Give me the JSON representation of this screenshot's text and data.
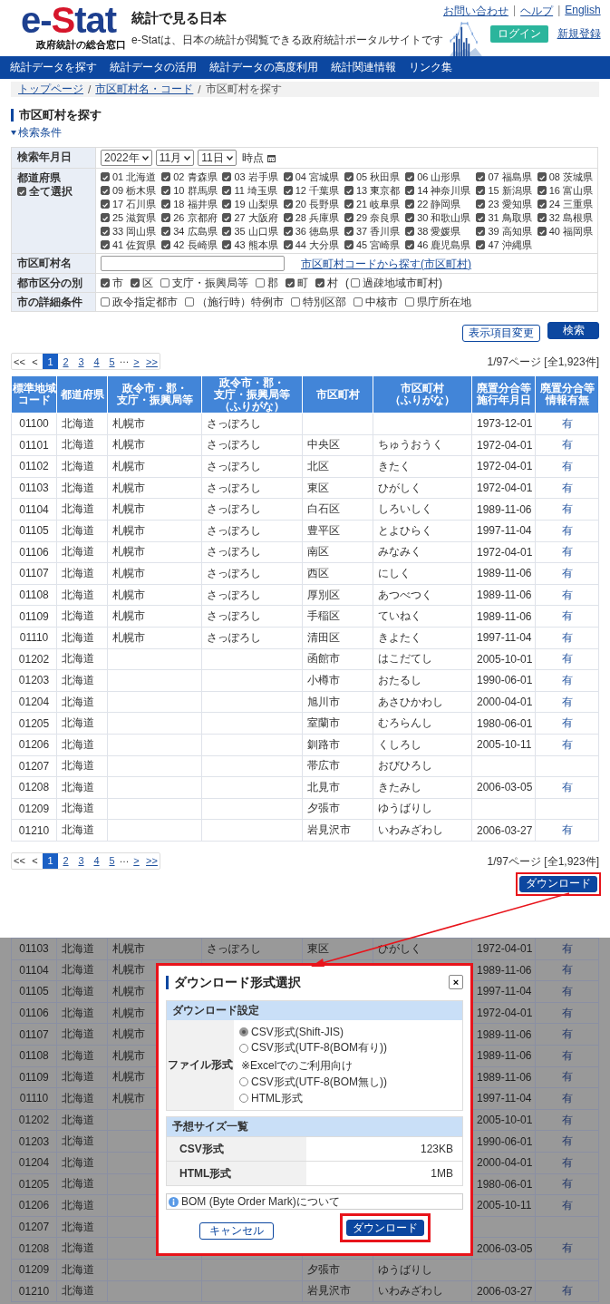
{
  "header": {
    "logo": {
      "parts": [
        {
          "text": "e-",
          "accent": false
        },
        {
          "text": "S",
          "accent": true
        },
        {
          "text": "tat",
          "accent": false
        }
      ],
      "subtitle": "政府統計の総合窓口"
    },
    "title": "統計で見る日本",
    "tagline": "e-Statは、日本の統計が閲覧できる政府統計ポータルサイトです",
    "links": [
      "お問い合わせ",
      "ヘルプ",
      "English"
    ],
    "link_separators": [
      "|",
      "|"
    ],
    "login": "ログイン",
    "register": "新規登録"
  },
  "nav": [
    "統計データを探す",
    "統計データの活用",
    "統計データの高度利用",
    "統計関連情報",
    "リンク集"
  ],
  "breadcrumb": {
    "items": [
      {
        "label": "トップページ",
        "link": true
      },
      {
        "label": "市区町村名・コード",
        "link": true
      },
      {
        "label": "市区町村を探す",
        "link": false
      }
    ],
    "separators": [
      "/",
      "/"
    ]
  },
  "page_title": "市区町村を探す",
  "search_conditions": {
    "label": "検索条件",
    "expanded": true
  },
  "form": [
    {
      "kind": "date",
      "label": "検索年月日",
      "selects": [
        "2022年",
        "11月",
        "11日"
      ],
      "suffix": "時点"
    },
    {
      "kind": "grid",
      "label": "都道府県",
      "select_all": {
        "label": "全て選択",
        "checked": true
      },
      "items": [
        {
          "label": "01 北海道",
          "checked": true
        },
        {
          "label": "02 青森県",
          "checked": true
        },
        {
          "label": "03 岩手県",
          "checked": true
        },
        {
          "label": "04 宮城県",
          "checked": true
        },
        {
          "label": "05 秋田県",
          "checked": true
        },
        {
          "label": "06 山形県",
          "checked": true
        },
        {
          "label": "07 福島県",
          "checked": true
        },
        {
          "label": "08 茨城県",
          "checked": true
        },
        {
          "label": "09 栃木県",
          "checked": true
        },
        {
          "label": "10 群馬県",
          "checked": true
        },
        {
          "label": "11 埼玉県",
          "checked": true
        },
        {
          "label": "12 千葉県",
          "checked": true
        },
        {
          "label": "13 東京都",
          "checked": true
        },
        {
          "label": "14 神奈川県",
          "checked": true
        },
        {
          "label": "15 新潟県",
          "checked": true
        },
        {
          "label": "16 富山県",
          "checked": true
        },
        {
          "label": "17 石川県",
          "checked": true
        },
        {
          "label": "18 福井県",
          "checked": true
        },
        {
          "label": "19 山梨県",
          "checked": true
        },
        {
          "label": "20 長野県",
          "checked": true
        },
        {
          "label": "21 岐阜県",
          "checked": true
        },
        {
          "label": "22 静岡県",
          "checked": true
        },
        {
          "label": "23 愛知県",
          "checked": true
        },
        {
          "label": "24 三重県",
          "checked": true
        },
        {
          "label": "25 滋賀県",
          "checked": true
        },
        {
          "label": "26 京都府",
          "checked": true
        },
        {
          "label": "27 大阪府",
          "checked": true
        },
        {
          "label": "28 兵庫県",
          "checked": true
        },
        {
          "label": "29 奈良県",
          "checked": true
        },
        {
          "label": "30 和歌山県",
          "checked": true
        },
        {
          "label": "31 鳥取県",
          "checked": true
        },
        {
          "label": "32 島根県",
          "checked": true
        },
        {
          "label": "33 岡山県",
          "checked": true
        },
        {
          "label": "34 広島県",
          "checked": true
        },
        {
          "label": "35 山口県",
          "checked": true
        },
        {
          "label": "36 徳島県",
          "checked": true
        },
        {
          "label": "37 香川県",
          "checked": true
        },
        {
          "label": "38 愛媛県",
          "checked": true
        },
        {
          "label": "39 高知県",
          "checked": true
        },
        {
          "label": "40 福岡県",
          "checked": true
        },
        {
          "label": "41 佐賀県",
          "checked": true
        },
        {
          "label": "42 長崎県",
          "checked": true
        },
        {
          "label": "43 熊本県",
          "checked": true
        },
        {
          "label": "44 大分県",
          "checked": true
        },
        {
          "label": "45 宮崎県",
          "checked": true
        },
        {
          "label": "46 鹿児島県",
          "checked": true
        },
        {
          "label": "47 沖縄県",
          "checked": true
        }
      ]
    },
    {
      "kind": "text",
      "label": "市区町村名",
      "link": "市区町村コードから探す(市区町村)"
    },
    {
      "kind": "checks",
      "label": "都市区分の別",
      "items": [
        {
          "label": "市",
          "checked": true
        },
        {
          "label": "区",
          "checked": true
        },
        {
          "label": "支庁・振興局等",
          "checked": false
        },
        {
          "label": "郡",
          "checked": false
        },
        {
          "label": "町",
          "checked": true
        },
        {
          "label": "村",
          "checked": true
        },
        {
          "prefix": "(",
          "label": "過疎地域市町村)",
          "checked": false
        }
      ]
    },
    {
      "kind": "checks",
      "label": "市の詳細条件",
      "items": [
        {
          "label": "政令指定都市",
          "checked": false
        },
        {
          "label": "（施行時）特例市",
          "checked": false
        },
        {
          "label": "特別区部",
          "checked": false
        },
        {
          "label": "中核市",
          "checked": false
        },
        {
          "label": "県庁所在地",
          "checked": false
        }
      ]
    }
  ],
  "buttons": [
    {
      "label": "表示項目変更",
      "kind": "secondary"
    },
    {
      "label": "検索",
      "kind": "primary"
    }
  ],
  "pagination_top": {
    "first": "<<",
    "prev": "<",
    "back_disabled": true,
    "pages": [
      {
        "label": "1",
        "selected": true
      },
      {
        "label": "2",
        "selected": false
      },
      {
        "label": "3",
        "selected": false
      },
      {
        "label": "4",
        "selected": false
      },
      {
        "label": "5",
        "selected": false
      }
    ],
    "ellipsis": "…",
    "next": ">",
    "last": ">>",
    "info": "1/97ページ [全1,923件]"
  },
  "table": {
    "columns": [
      [
        "標準地域",
        "コード"
      ],
      [
        "都道府県"
      ],
      [
        "政令市・郡・",
        "支庁・振興局等"
      ],
      [
        "政令市・郡・",
        "支庁・振興局等",
        "（ふりがな）"
      ],
      [
        "市区町村"
      ],
      [
        "市区町村",
        "（ふりがな）"
      ],
      [
        "廃置分合等",
        "施行年月日"
      ],
      [
        "廃置分合等",
        "情報有無"
      ]
    ],
    "rows": [
      {
        "code": "01100",
        "prefecture": "北海道",
        "city": "札幌市",
        "city_kana": "さっぽろし",
        "date": "1973-12-01",
        "info": "有"
      },
      {
        "code": "01101",
        "prefecture": "北海道",
        "city": "札幌市",
        "city_kana": "さっぽろし",
        "municipality": "中央区",
        "municipality_kana": "ちゅうおうく",
        "date": "1972-04-01",
        "info": "有"
      },
      {
        "code": "01102",
        "prefecture": "北海道",
        "city": "札幌市",
        "city_kana": "さっぽろし",
        "municipality": "北区",
        "municipality_kana": "きたく",
        "date": "1972-04-01",
        "info": "有"
      },
      {
        "code": "01103",
        "prefecture": "北海道",
        "city": "札幌市",
        "city_kana": "さっぽろし",
        "municipality": "東区",
        "municipality_kana": "ひがしく",
        "date": "1972-04-01",
        "info": "有"
      },
      {
        "code": "01104",
        "prefecture": "北海道",
        "city": "札幌市",
        "city_kana": "さっぽろし",
        "municipality": "白石区",
        "municipality_kana": "しろいしく",
        "date": "1989-11-06",
        "info": "有"
      },
      {
        "code": "01105",
        "prefecture": "北海道",
        "city": "札幌市",
        "city_kana": "さっぽろし",
        "municipality": "豊平区",
        "municipality_kana": "とよひらく",
        "date": "1997-11-04",
        "info": "有"
      },
      {
        "code": "01106",
        "prefecture": "北海道",
        "city": "札幌市",
        "city_kana": "さっぽろし",
        "municipality": "南区",
        "municipality_kana": "みなみく",
        "date": "1972-04-01",
        "info": "有"
      },
      {
        "code": "01107",
        "prefecture": "北海道",
        "city": "札幌市",
        "city_kana": "さっぽろし",
        "municipality": "西区",
        "municipality_kana": "にしく",
        "date": "1989-11-06",
        "info": "有"
      },
      {
        "code": "01108",
        "prefecture": "北海道",
        "city": "札幌市",
        "city_kana": "さっぽろし",
        "municipality": "厚別区",
        "municipality_kana": "あつべつく",
        "date": "1989-11-06",
        "info": "有"
      },
      {
        "code": "01109",
        "prefecture": "北海道",
        "city": "札幌市",
        "city_kana": "さっぽろし",
        "municipality": "手稲区",
        "municipality_kana": "ていねく",
        "date": "1989-11-06",
        "info": "有"
      },
      {
        "code": "01110",
        "prefecture": "北海道",
        "city": "札幌市",
        "city_kana": "さっぽろし",
        "municipality": "清田区",
        "municipality_kana": "きよたく",
        "date": "1997-11-04",
        "info": "有"
      },
      {
        "code": "01202",
        "prefecture": "北海道",
        "municipality": "函館市",
        "municipality_kana": "はこだてし",
        "date": "2005-10-01",
        "info": "有"
      },
      {
        "code": "01203",
        "prefecture": "北海道",
        "municipality": "小樽市",
        "municipality_kana": "おたるし",
        "date": "1990-06-01",
        "info": "有"
      },
      {
        "code": "01204",
        "prefecture": "北海道",
        "municipality": "旭川市",
        "municipality_kana": "あさひかわし",
        "date": "2000-04-01",
        "info": "有"
      },
      {
        "code": "01205",
        "prefecture": "北海道",
        "municipality": "室蘭市",
        "municipality_kana": "むろらんし",
        "date": "1980-06-01",
        "info": "有"
      },
      {
        "code": "01206",
        "prefecture": "北海道",
        "municipality": "釧路市",
        "municipality_kana": "くしろし",
        "date": "2005-10-11",
        "info": "有"
      },
      {
        "code": "01207",
        "prefecture": "北海道",
        "municipality": "帯広市",
        "municipality_kana": "おびひろし"
      },
      {
        "code": "01208",
        "prefecture": "北海道",
        "municipality": "北見市",
        "municipality_kana": "きたみし",
        "date": "2006-03-05",
        "info": "有"
      },
      {
        "code": "01209",
        "prefecture": "北海道",
        "municipality": "夕張市",
        "municipality_kana": "ゆうばりし"
      },
      {
        "code": "01210",
        "prefecture": "北海道",
        "municipality": "岩見沢市",
        "municipality_kana": "いわみざわし",
        "date": "2006-03-27",
        "info": "有"
      }
    ]
  },
  "pagination_bottom": {
    "first": "<<",
    "prev": "<",
    "back_disabled": true,
    "pages": [
      {
        "label": "1",
        "selected": true
      },
      {
        "label": "2",
        "selected": false
      },
      {
        "label": "3",
        "selected": false
      },
      {
        "label": "4",
        "selected": false
      },
      {
        "label": "5",
        "selected": false
      }
    ],
    "ellipsis": "…",
    "next": ">",
    "last": ">>",
    "info": "1/97ページ [全1,923件]"
  },
  "download_button": "ダウンロード",
  "background_table": {
    "rows": [
      {
        "code": "01103",
        "prefecture": "北海道",
        "city": "札幌市",
        "city_kana": "さっぽろし",
        "municipality": "東区",
        "municipality_kana": "ひがしく",
        "date": "1972-04-01",
        "info": "有"
      },
      {
        "code": "01104",
        "prefecture": "北海道",
        "city": "札幌市",
        "date": "1989-11-06",
        "info": "有"
      },
      {
        "code": "01105",
        "prefecture": "北海道",
        "city": "札幌市",
        "date": "1997-11-04",
        "info": "有"
      },
      {
        "code": "01106",
        "prefecture": "北海道",
        "city": "札幌市",
        "date": "1972-04-01",
        "info": "有"
      },
      {
        "code": "01107",
        "prefecture": "北海道",
        "city": "札幌市",
        "date": "1989-11-06",
        "info": "有"
      },
      {
        "code": "01108",
        "prefecture": "北海道",
        "city": "札幌市",
        "date": "1989-11-06",
        "info": "有"
      },
      {
        "code": "01109",
        "prefecture": "北海道",
        "city": "札幌市",
        "date": "1989-11-06",
        "info": "有"
      },
      {
        "code": "01110",
        "prefecture": "北海道",
        "city": "札幌市",
        "date": "1997-11-04",
        "info": "有"
      },
      {
        "code": "01202",
        "prefecture": "北海道",
        "date": "2005-10-01",
        "info": "有"
      },
      {
        "code": "01203",
        "prefecture": "北海道",
        "date": "1990-06-01",
        "info": "有"
      },
      {
        "code": "01204",
        "prefecture": "北海道",
        "date": "2000-04-01",
        "info": "有"
      },
      {
        "code": "01205",
        "prefecture": "北海道",
        "date": "1980-06-01",
        "info": "有"
      },
      {
        "code": "01206",
        "prefecture": "北海道",
        "date": "2005-10-11",
        "info": "有"
      },
      {
        "code": "01207",
        "prefecture": "北海道"
      },
      {
        "code": "01208",
        "prefecture": "北海道",
        "date": "2006-03-05",
        "info": "有"
      },
      {
        "code": "01209",
        "prefecture": "北海道",
        "municipality": "夕張市",
        "municipality_kana": "ゆうばりし"
      },
      {
        "code": "01210",
        "prefecture": "北海道",
        "municipality": "岩見沢市",
        "municipality_kana": "いわみざわし",
        "date": "2006-03-27",
        "info": "有"
      }
    ]
  },
  "dialog": {
    "title": "ダウンロード形式選択",
    "close": "×",
    "settings": {
      "heading": "ダウンロード設定",
      "label": "ファイル形式",
      "options": [
        {
          "label": "CSV形式(Shift-JIS)",
          "selected": true
        },
        {
          "label": "CSV形式(UTF-8(BOM有り))",
          "note": "※Excelでのご利用向け",
          "selected": false
        },
        {
          "label": "CSV形式(UTF-8(BOM無し))",
          "selected": false
        },
        {
          "label": "HTML形式",
          "selected": false
        }
      ]
    },
    "sizes": {
      "heading": "予想サイズ一覧",
      "rows": [
        {
          "format": "CSV形式",
          "size": "123KB"
        },
        {
          "format": "HTML形式",
          "size": "1MB"
        }
      ]
    },
    "info_link": "BOM (Byte Order Mark)について",
    "cancel": "キャンセル",
    "download": "ダウンロード"
  }
}
